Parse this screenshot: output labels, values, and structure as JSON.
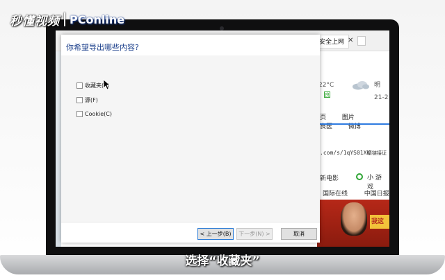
{
  "watermark": {
    "brand_cn": "秒懂视频",
    "brand_en": "PConline"
  },
  "subtitle": "选择“收藏夹”",
  "browser": {
    "tab_label": "安全上网",
    "temperature": "22°C",
    "weather_badge": "良",
    "forecast_today": "明",
    "forecast_range": "21-2",
    "nav_links": [
      "图片",
      "图片",
      "良医",
      "微博"
    ],
    "nav_first": "页",
    "short_url": ".com/s/1qYS01XK",
    "short_url_extra": "请链接证",
    "row1_left": "新电影",
    "row1_right": "小 游 戏",
    "row2_left": "国际在线",
    "row2_right": "中国日报",
    "promo_text": "我这"
  },
  "dialog": {
    "title": "你希望导出哪些内容?",
    "options": [
      {
        "label": "收藏夹(A)",
        "checked": false
      },
      {
        "label": "源(F)",
        "checked": false
      },
      {
        "label": "Cookie(C)",
        "checked": false
      }
    ],
    "buttons": {
      "back": "< 上一步(B)",
      "next": "下一步(N) >",
      "cancel": "取消"
    }
  }
}
